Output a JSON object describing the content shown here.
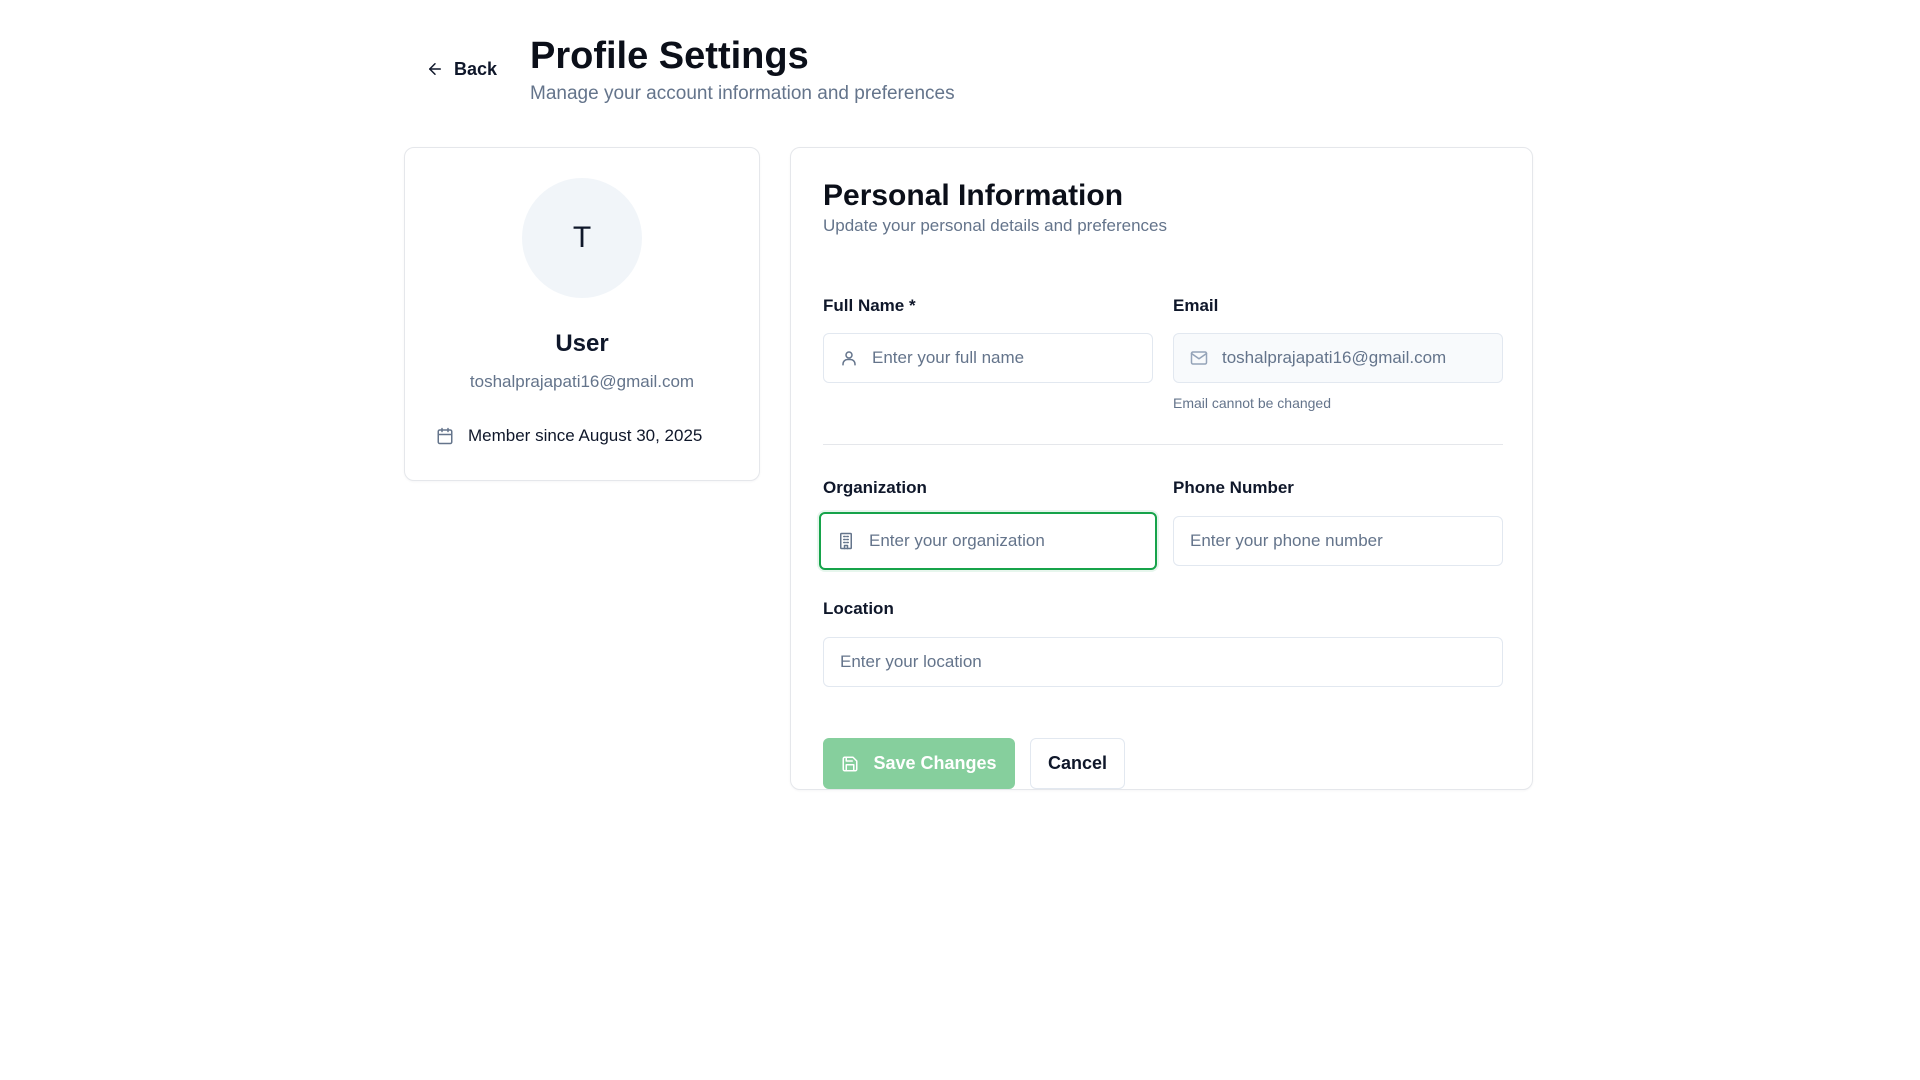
{
  "header": {
    "back_label": "Back",
    "title": "Profile Settings",
    "subtitle": "Manage your account information and preferences"
  },
  "profile": {
    "avatar_initial": "T",
    "name": "User",
    "email": "toshalprajapati16@gmail.com",
    "member_since": "Member since August 30, 2025",
    "icons": {
      "calendar": "calendar-icon"
    }
  },
  "form": {
    "title": "Personal Information",
    "subtitle": "Update your personal details and preferences",
    "full_name": {
      "label": "Full Name *",
      "placeholder": "Enter your full name",
      "value": "",
      "icon": "user-icon"
    },
    "email": {
      "label": "Email",
      "value": "toshalprajapati16@gmail.com",
      "help": "Email cannot be changed",
      "icon": "mail-icon",
      "disabled": true
    },
    "organization": {
      "label": "Organization",
      "placeholder": "Enter your organization",
      "value": "",
      "icon": "building-icon",
      "focused": true
    },
    "phone": {
      "label": "Phone Number",
      "placeholder": "Enter your phone number",
      "value": ""
    },
    "location": {
      "label": "Location",
      "placeholder": "Enter your location",
      "value": ""
    },
    "save_label": "Save Changes",
    "cancel_label": "Cancel"
  },
  "colors": {
    "accent_focus": "#16a34a",
    "save_button_bg": "#86cf9d",
    "muted_text": "#64748b",
    "border": "#e2e8f0"
  }
}
